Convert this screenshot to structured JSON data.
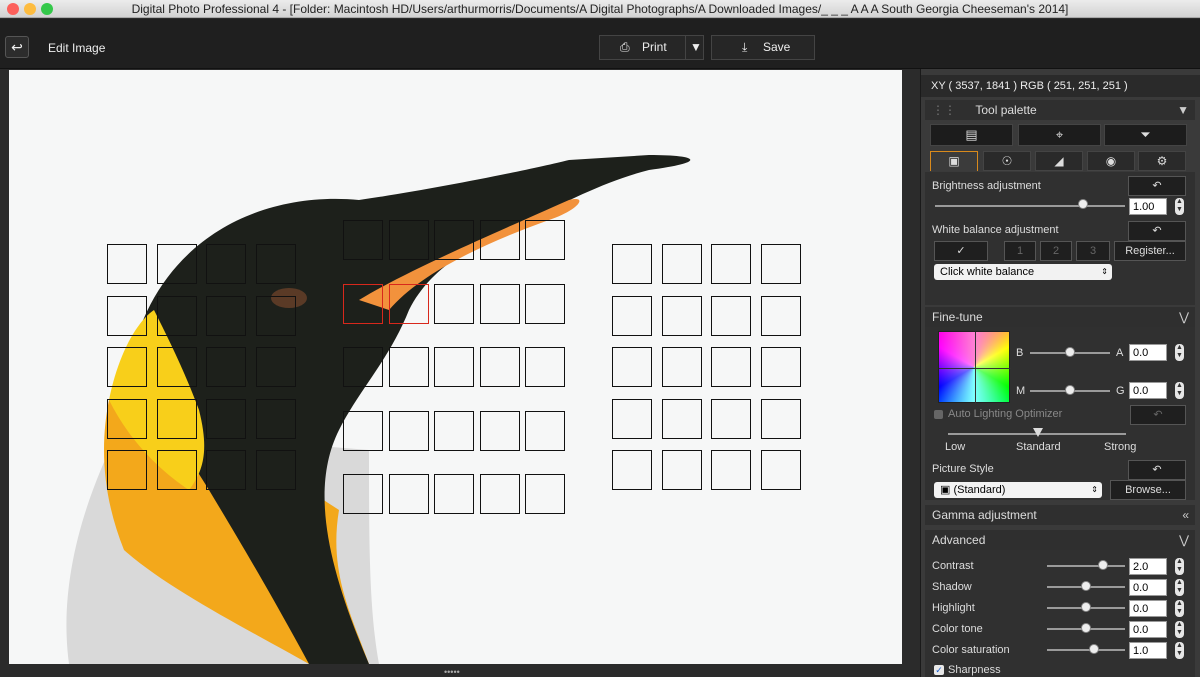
{
  "window": {
    "title": "Digital Photo Professional 4 - [Folder: Macintosh HD/Users/arthurmorris/Documents/A Digital Photographs/A Downloaded Images/_ _ _ A A A South Georgia Cheeseman's 2014]"
  },
  "toolbar": {
    "back_icon": "back-arrow-icon",
    "title": "Edit Image",
    "print_label": "Print",
    "save_label": "Save"
  },
  "status": {
    "xy_readout": "XY (   3537,    1841 ) RGB ( 251,  251,  251 )"
  },
  "tool_palette": {
    "title": "Tool palette",
    "top_tools": [
      "histogram-icon",
      "crop-icon",
      "stamp-icon"
    ],
    "tabs": [
      "basic-icon",
      "detail-icon",
      "tone-curve-icon",
      "color-icon",
      "settings-icon"
    ],
    "brightness": {
      "label": "Brightness adjustment",
      "value": "1.00",
      "level": 0.78
    },
    "white_balance": {
      "label": "White balance adjustment",
      "buttons": [
        "1",
        "2",
        "3"
      ],
      "register": "Register...",
      "select": "Click white balance"
    },
    "fine_tune": {
      "label": "Fine-tune",
      "b": "B",
      "a": "A",
      "m": "M",
      "g": "G",
      "value_a": "0.0",
      "value_g": "0.0"
    },
    "alo": {
      "label": "Auto Lighting Optimizer",
      "low": "Low",
      "standard": "Standard",
      "strong": "Strong"
    },
    "picture_style": {
      "label": "Picture Style",
      "select": "(Standard)",
      "browse": "Browse..."
    },
    "gamma": {
      "label": "Gamma adjustment"
    },
    "advanced": {
      "label": "Advanced",
      "rows": [
        {
          "label": "Contrast",
          "value": "2.0"
        },
        {
          "label": "Shadow",
          "value": "0.0"
        },
        {
          "label": "Highlight",
          "value": "0.0"
        },
        {
          "label": "Color tone",
          "value": "0.0"
        },
        {
          "label": "Color saturation",
          "value": "1.0"
        }
      ]
    },
    "sharpness": {
      "label": "Sharpness",
      "checked": true
    }
  }
}
